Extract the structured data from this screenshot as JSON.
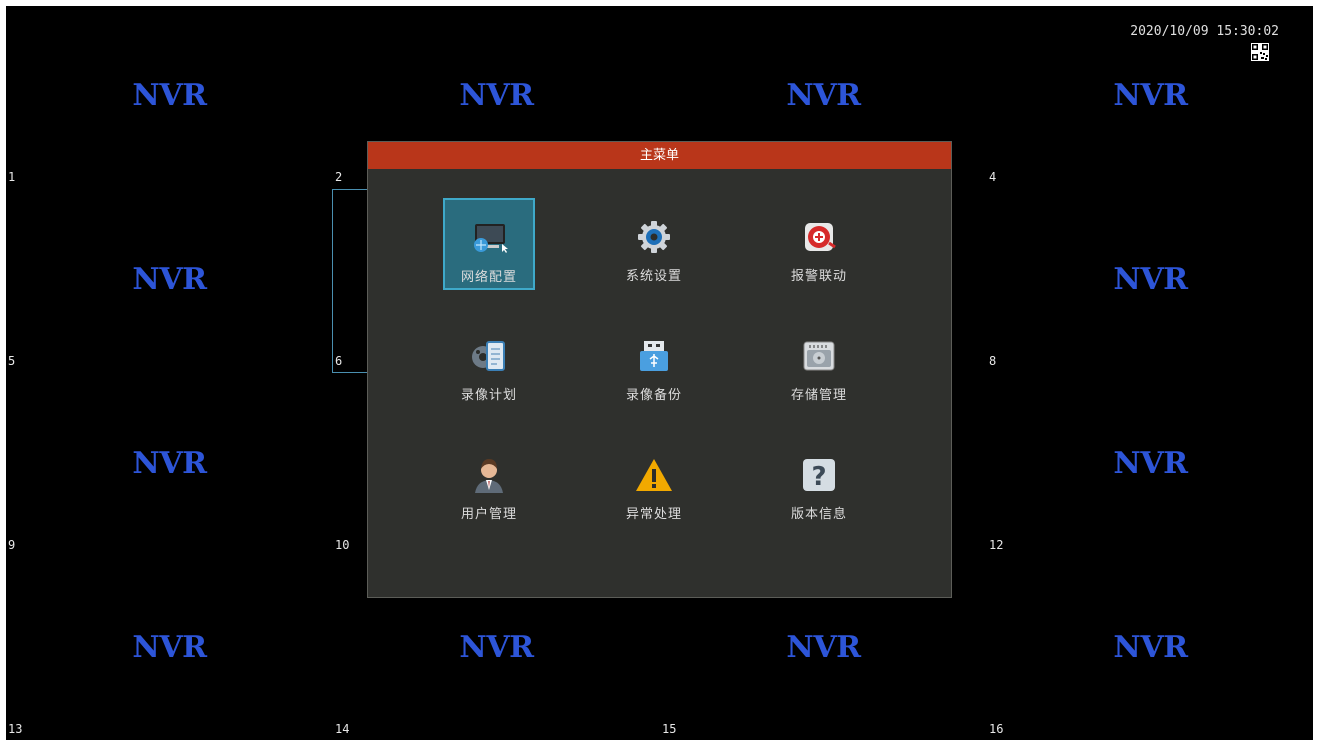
{
  "clock": "2020/10/09 15:30:02",
  "grid": {
    "logo_text": "NVR",
    "cells": [
      {
        "num": "1",
        "logo": true
      },
      {
        "num": "2",
        "logo": true
      },
      {
        "num": "",
        "logo": true
      },
      {
        "num": "4",
        "logo": true
      },
      {
        "num": "5",
        "logo": true
      },
      {
        "num": "6",
        "logo": false
      },
      {
        "num": "",
        "logo": false
      },
      {
        "num": "8",
        "logo": true
      },
      {
        "num": "9",
        "logo": true
      },
      {
        "num": "10",
        "logo": false
      },
      {
        "num": "",
        "logo": false
      },
      {
        "num": "12",
        "logo": true
      },
      {
        "num": "13",
        "logo": true
      },
      {
        "num": "14",
        "logo": true
      },
      {
        "num": "15",
        "logo": true
      },
      {
        "num": "16",
        "logo": true
      }
    ]
  },
  "menu": {
    "title": "主菜单",
    "items": [
      {
        "label": "网络配置",
        "icon": "network-monitor-icon",
        "active": true
      },
      {
        "label": "系统设置",
        "icon": "gear-icon",
        "active": false
      },
      {
        "label": "报警联动",
        "icon": "alarm-icon",
        "active": false
      },
      {
        "label": "录像计划",
        "icon": "film-schedule-icon",
        "active": false
      },
      {
        "label": "录像备份",
        "icon": "usb-backup-icon",
        "active": false
      },
      {
        "label": "存储管理",
        "icon": "hard-disk-icon",
        "active": false
      },
      {
        "label": "用户管理",
        "icon": "user-icon",
        "active": false
      },
      {
        "label": "异常处理",
        "icon": "warning-icon",
        "active": false
      },
      {
        "label": "版本信息",
        "icon": "question-icon",
        "active": false
      }
    ]
  },
  "colors": {
    "logo": "#2d55d8",
    "title_bar": "#b9361a",
    "active_item": "#2a6c7e"
  }
}
